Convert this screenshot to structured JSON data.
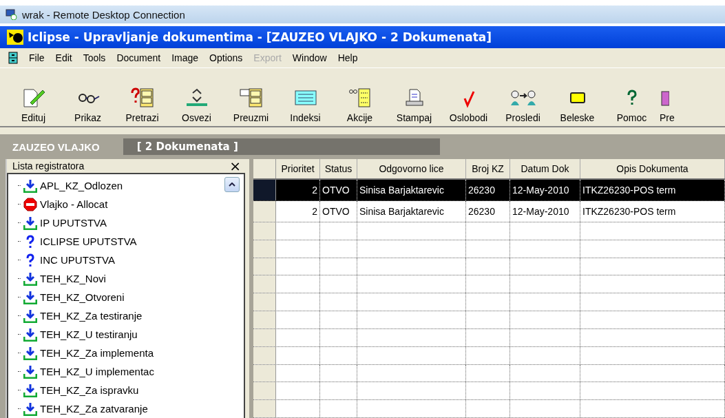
{
  "rdp_window": {
    "title": "wrak - Remote Desktop Connection"
  },
  "app_window": {
    "title": "Iclipse - Upravljanje dokumentima - [ZAUZEO VLAJKO - 2 Dokumenata]"
  },
  "menu": [
    {
      "label": "File",
      "disabled": false
    },
    {
      "label": "Edit",
      "disabled": false
    },
    {
      "label": "Tools",
      "disabled": false
    },
    {
      "label": "Document",
      "disabled": false
    },
    {
      "label": "Image",
      "disabled": false
    },
    {
      "label": "Options",
      "disabled": false
    },
    {
      "label": "Export",
      "disabled": true
    },
    {
      "label": "Window",
      "disabled": false
    },
    {
      "label": "Help",
      "disabled": false
    }
  ],
  "toolbar": [
    "Edituj",
    "Prikaz",
    "Pretrazi",
    "Osvezi",
    "Preuzmi",
    "Indeksi",
    "Akcije",
    "Stampaj",
    "Oslobodi",
    "Prosledi",
    "Beleske",
    "Pomoc",
    "Pre"
  ],
  "header": {
    "user": "ZAUZEO VLAJKO",
    "count": "[ 2 Dokumenata ]"
  },
  "sidebar": {
    "title": "Lista registratora",
    "close": "×",
    "items": [
      {
        "label": "APL_KZ_Odlozen",
        "kind": "download"
      },
      {
        "label": "Vlajko - Allocat",
        "kind": "stop"
      },
      {
        "label": "IP UPUTSTVA",
        "kind": "download"
      },
      {
        "label": "ICLIPSE UPUTSTVA",
        "kind": "help"
      },
      {
        "label": "INC UPUTSTVA",
        "kind": "help"
      },
      {
        "label": "TEH_KZ_Novi",
        "kind": "download"
      },
      {
        "label": "TEH_KZ_Otvoreni",
        "kind": "download"
      },
      {
        "label": "TEH_KZ_Za testiranje",
        "kind": "download"
      },
      {
        "label": "TEH_KZ_U testiranju",
        "kind": "download"
      },
      {
        "label": "TEH_KZ_Za implementa",
        "kind": "download"
      },
      {
        "label": "TEH_KZ_U implementac",
        "kind": "download"
      },
      {
        "label": "TEH_KZ_Za ispravku",
        "kind": "download"
      },
      {
        "label": "TEH_KZ_Za zatvaranje",
        "kind": "download"
      }
    ]
  },
  "table": {
    "columns": [
      "Prioritet",
      "Status",
      "Odgovorno lice",
      "Broj KZ",
      "Datum Dok",
      "Opis Dokumenta"
    ],
    "rows": [
      {
        "selected": true,
        "cells": [
          "2",
          "OTVO",
          "Sinisa Barjaktarevic",
          "26230",
          "12-May-2010",
          "ITKZ26230-POS term"
        ]
      },
      {
        "selected": false,
        "cells": [
          "2",
          "OTVO",
          "Sinisa Barjaktarevic",
          "26230",
          "12-May-2010",
          "ITKZ26230-POS term"
        ]
      }
    ]
  }
}
